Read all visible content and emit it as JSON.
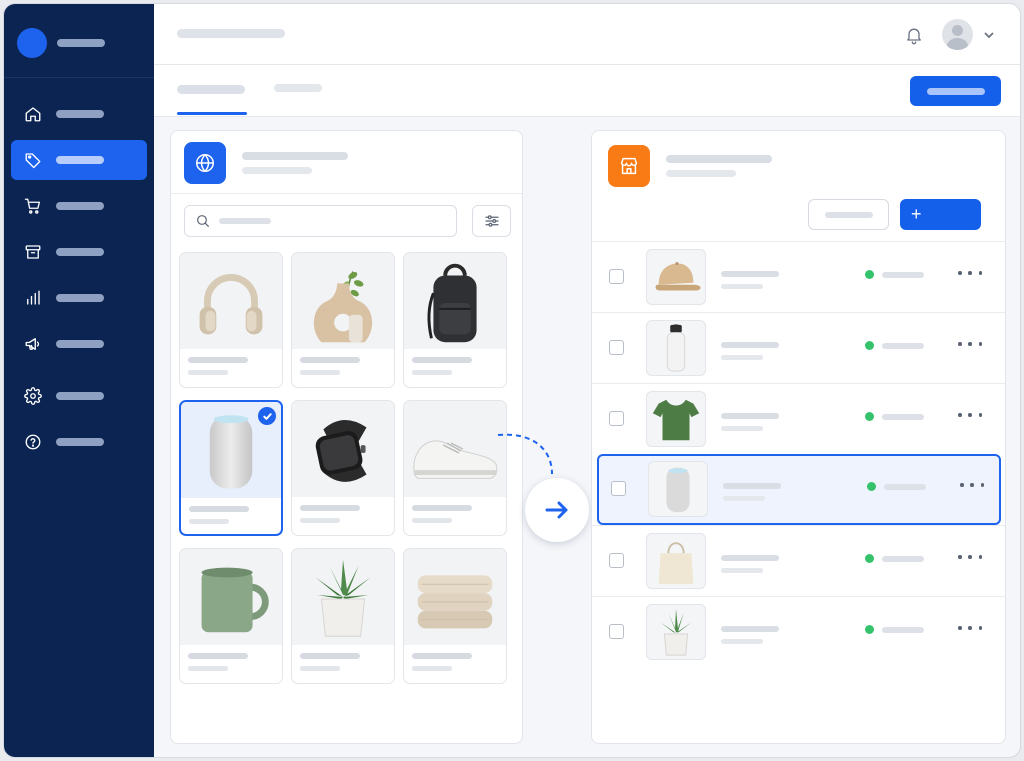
{
  "colors": {
    "sidebar_bg": "#0b2452",
    "accent": "#1d63ee",
    "store_icon": "#f97b16",
    "status_active": "#34c36b"
  },
  "sidebar": {
    "brand_icon": "brand-logo",
    "items": [
      {
        "icon": "home-icon",
        "active": false
      },
      {
        "icon": "tag-icon",
        "active": true
      },
      {
        "icon": "cart-icon",
        "active": false
      },
      {
        "icon": "archive-icon",
        "active": false
      },
      {
        "icon": "bar-chart-icon",
        "active": false
      },
      {
        "icon": "megaphone-icon",
        "active": false
      },
      {
        "icon": "gear-icon",
        "active": false
      },
      {
        "icon": "help-icon",
        "active": false
      }
    ]
  },
  "header": {
    "icons": [
      "bell-icon",
      "avatar",
      "chevron-down-icon"
    ]
  },
  "tabs": {
    "active_index": 0,
    "count": 2
  },
  "catalog_panel": {
    "header_icon": "globe-icon",
    "search_icon": "search-icon",
    "filter_icon": "sliders-icon",
    "products": [
      {
        "image": "headphones",
        "selected": false
      },
      {
        "image": "ceramic-vase-with-plant",
        "selected": false
      },
      {
        "image": "black-backpack",
        "selected": false
      },
      {
        "image": "smart-speaker",
        "selected": true
      },
      {
        "image": "smartwatch",
        "selected": false
      },
      {
        "image": "white-sneaker",
        "selected": false
      },
      {
        "image": "green-mug",
        "selected": false
      },
      {
        "image": "potted-succulent",
        "selected": false
      },
      {
        "image": "folded-towels",
        "selected": false
      }
    ]
  },
  "transfer": {
    "icon": "arrow-right-icon"
  },
  "store_panel": {
    "header_icon": "storefront-icon",
    "add_button_label": "+",
    "rows": [
      {
        "image": "baseball-cap",
        "status": "active",
        "highlighted": false
      },
      {
        "image": "water-bottle",
        "status": "active",
        "highlighted": false
      },
      {
        "image": "green-t-shirt",
        "status": "active",
        "highlighted": false
      },
      {
        "image": "smart-speaker",
        "status": "active",
        "highlighted": true
      },
      {
        "image": "tote-bag",
        "status": "active",
        "highlighted": false
      },
      {
        "image": "potted-succulent",
        "status": "active",
        "highlighted": false
      }
    ]
  }
}
